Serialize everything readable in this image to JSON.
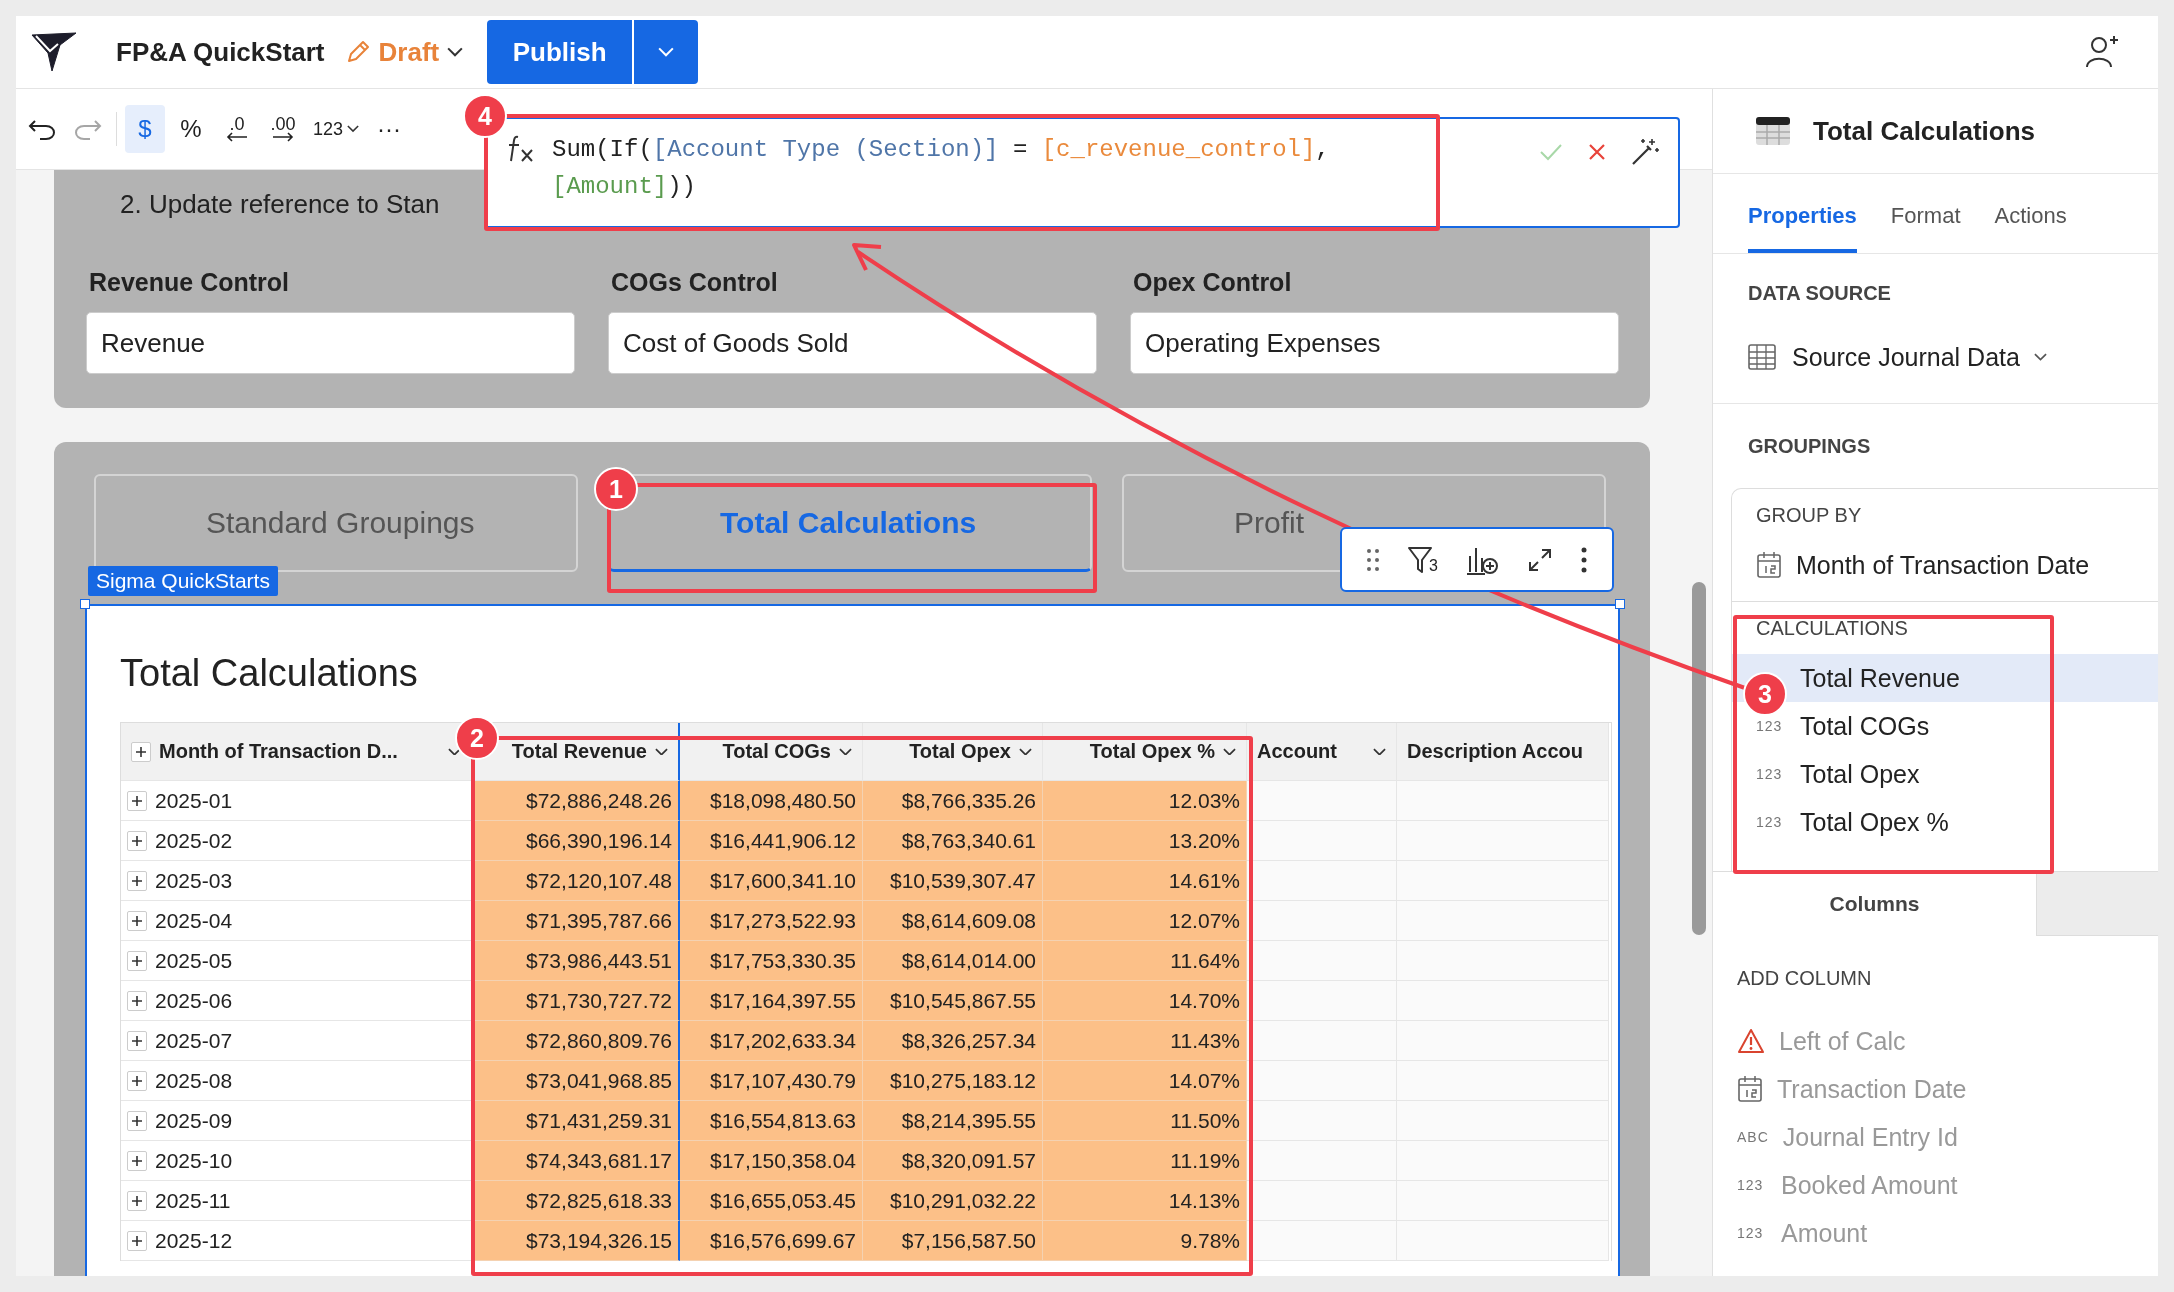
{
  "app": {
    "title": "FP&A QuickStart",
    "status": "Draft",
    "publish": "Publish"
  },
  "toolbar": [
    {
      "kind": "undo",
      "disabled": false
    },
    {
      "kind": "redo",
      "disabled": true
    },
    {
      "kind": "currency",
      "label": "$",
      "selected": true,
      "disabled": false
    },
    {
      "kind": "percent",
      "label": "%",
      "selected": false,
      "disabled": false
    },
    {
      "kind": "decrease_decimals",
      "label": ".0",
      "disabled": false
    },
    {
      "kind": "increase_decimals",
      "label": ".00",
      "disabled": false
    },
    {
      "kind": "number_format",
      "label": "123",
      "disabled": false
    },
    {
      "kind": "more",
      "label": "···",
      "disabled": false
    }
  ],
  "formula": {
    "lines": [
      [
        {
          "kind": "plain",
          "text": "Sum(If("
        },
        {
          "kind": "source_column",
          "text": "[Account Type (Section)]"
        },
        {
          "kind": "plain",
          "text": " = "
        },
        {
          "kind": "control",
          "text": "[c_revenue_control]"
        },
        {
          "kind": "plain",
          "text": ","
        }
      ],
      [
        {
          "kind": "table_column",
          "text": "[Amount]"
        },
        {
          "kind": "plain",
          "text": "))"
        }
      ]
    ]
  },
  "canvas": {
    "instruction": "2. Update reference to Stan",
    "controls": [
      {
        "label": "Revenue Control",
        "value": "Revenue"
      },
      {
        "label": "COGs Control",
        "value": "Cost of Goods Sold"
      },
      {
        "label": "Opex Control",
        "value": "Operating Expenses"
      }
    ],
    "tabs": [
      {
        "label": "Standard Groupings",
        "selected": false
      },
      {
        "label": "Total Calculations",
        "selected": true
      },
      {
        "label": "Profit",
        "selected": false
      }
    ],
    "element": {
      "label": "Sigma QuickStarts",
      "filter_count": "3",
      "title": "Total Calculations",
      "columns": [
        {
          "label": "Month of Transaction D...",
          "expandable": true,
          "menu": true,
          "selected": false,
          "highlighted": false
        },
        {
          "label": "Total Revenue",
          "expandable": false,
          "menu": true,
          "selected": true,
          "highlighted": true
        },
        {
          "label": "Total COGs",
          "expandable": false,
          "menu": true,
          "selected": false,
          "highlighted": true
        },
        {
          "label": "Total Opex",
          "expandable": false,
          "menu": true,
          "selected": false,
          "highlighted": true
        },
        {
          "label": "Total Opex %",
          "expandable": false,
          "menu": true,
          "selected": false,
          "highlighted": true
        },
        {
          "label": "Account",
          "expandable": false,
          "menu": true,
          "selected": false,
          "highlighted": false
        },
        {
          "label": "Description Accou",
          "expandable": false,
          "menu": false,
          "selected": false,
          "highlighted": false
        }
      ],
      "rows": [
        [
          "2025-01",
          "$72,886,248.26",
          "$18,098,480.50",
          "$8,766,335.26",
          "12.03%"
        ],
        [
          "2025-02",
          "$66,390,196.14",
          "$16,441,906.12",
          "$8,763,340.61",
          "13.20%"
        ],
        [
          "2025-03",
          "$72,120,107.48",
          "$17,600,341.10",
          "$10,539,307.47",
          "14.61%"
        ],
        [
          "2025-04",
          "$71,395,787.66",
          "$17,273,522.93",
          "$8,614,609.08",
          "12.07%"
        ],
        [
          "2025-05",
          "$73,986,443.51",
          "$17,753,330.35",
          "$8,614,014.00",
          "11.64%"
        ],
        [
          "2025-06",
          "$71,730,727.72",
          "$17,164,397.55",
          "$10,545,867.55",
          "14.70%"
        ],
        [
          "2025-07",
          "$72,860,809.76",
          "$17,202,633.34",
          "$8,326,257.34",
          "11.43%"
        ],
        [
          "2025-08",
          "$73,041,968.85",
          "$17,107,430.79",
          "$10,275,183.12",
          "14.07%"
        ],
        [
          "2025-09",
          "$71,431,259.31",
          "$16,554,813.63",
          "$8,214,395.55",
          "11.50%"
        ],
        [
          "2025-10",
          "$74,343,681.17",
          "$17,150,358.04",
          "$8,320,091.57",
          "11.19%"
        ],
        [
          "2025-11",
          "$72,825,618.33",
          "$16,655,053.45",
          "$10,291,032.22",
          "14.13%"
        ],
        [
          "2025-12",
          "$73,194,326.15",
          "$16,576,699.67",
          "$7,156,587.50",
          "9.78%"
        ]
      ]
    }
  },
  "panel": {
    "title": "Total Calculations",
    "tabs": [
      {
        "label": "Properties",
        "selected": true
      },
      {
        "label": "Format",
        "selected": false
      },
      {
        "label": "Actions",
        "selected": false
      }
    ],
    "data_source": {
      "heading": "DATA SOURCE",
      "value": "Source Journal Data"
    },
    "groupings": {
      "heading": "GROUPINGS",
      "group_by": {
        "heading": "GROUP BY",
        "items": [
          {
            "kind": "date",
            "label": "Month of Transaction Date"
          }
        ]
      },
      "calculations": {
        "heading": "CALCULATIONS",
        "items": [
          {
            "label": "Total Revenue",
            "selected": true
          },
          {
            "type": "123",
            "label": "Total COGs",
            "selected": false
          },
          {
            "type": "123",
            "label": "Total Opex",
            "selected": false
          },
          {
            "type": "123",
            "label": "Total Opex %",
            "selected": false
          }
        ]
      }
    },
    "bottom_tabs": [
      {
        "label": "Columns",
        "selected": true
      }
    ],
    "add_column": {
      "heading": "ADD COLUMN",
      "items": [
        {
          "kind": "warning",
          "label": "Left of Calc"
        },
        {
          "kind": "date",
          "label": "Transaction Date"
        },
        {
          "kind": "text",
          "type": "ABC",
          "label": "Journal Entry Id"
        },
        {
          "kind": "number",
          "type": "123",
          "label": "Booked Amount"
        },
        {
          "kind": "number",
          "type": "123",
          "label": "Amount"
        }
      ]
    }
  },
  "annotations": [
    {
      "label": "1"
    },
    {
      "label": "2"
    },
    {
      "label": "3"
    },
    {
      "label": "4"
    }
  ]
}
